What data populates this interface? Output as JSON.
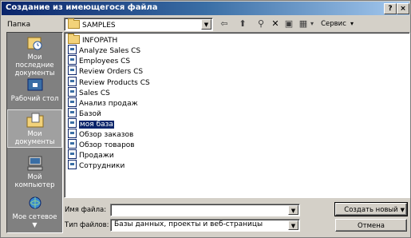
{
  "window": {
    "title": "Создание из имеющегося файла"
  },
  "title_buttons": {
    "help": "?",
    "close": "×"
  },
  "lookin": {
    "label": "Папка",
    "value": "SAMPLES"
  },
  "toolbar": {
    "back": "⇦",
    "up": "⬆",
    "search": "⚲",
    "delete": "✕",
    "newfolder": "▣",
    "views": "▦",
    "views_arrow": "▾",
    "tools": "Сервис",
    "tools_arrow": "▾"
  },
  "sidebar": {
    "items": [
      {
        "label": "Мои последние документы"
      },
      {
        "label": "Рабочий стол"
      },
      {
        "label": "Мои документы"
      },
      {
        "label": "Мой компьютер"
      },
      {
        "label": "Мое сетевое"
      }
    ]
  },
  "files": [
    {
      "name": "INFOPATH",
      "type": "folder"
    },
    {
      "name": "Analyze Sales CS",
      "type": "file"
    },
    {
      "name": "Employees CS",
      "type": "file"
    },
    {
      "name": "Review Orders CS",
      "type": "file"
    },
    {
      "name": "Review Products CS",
      "type": "file"
    },
    {
      "name": "Sales CS",
      "type": "file"
    },
    {
      "name": "Анализ продаж",
      "type": "file"
    },
    {
      "name": "Базой",
      "type": "file"
    },
    {
      "name": "моя база",
      "type": "file",
      "selected": true
    },
    {
      "name": "Обзор заказов",
      "type": "file"
    },
    {
      "name": "Обзор товаров",
      "type": "file"
    },
    {
      "name": "Продажи",
      "type": "file"
    },
    {
      "name": "Сотрудники",
      "type": "file"
    }
  ],
  "filename": {
    "label": "Имя файла:",
    "value": ""
  },
  "filetype": {
    "label": "Тип файлов:",
    "value": "Базы данных, проекты и веб-страницы"
  },
  "buttons": {
    "create": "Создать новый",
    "cancel": "Отмена"
  }
}
